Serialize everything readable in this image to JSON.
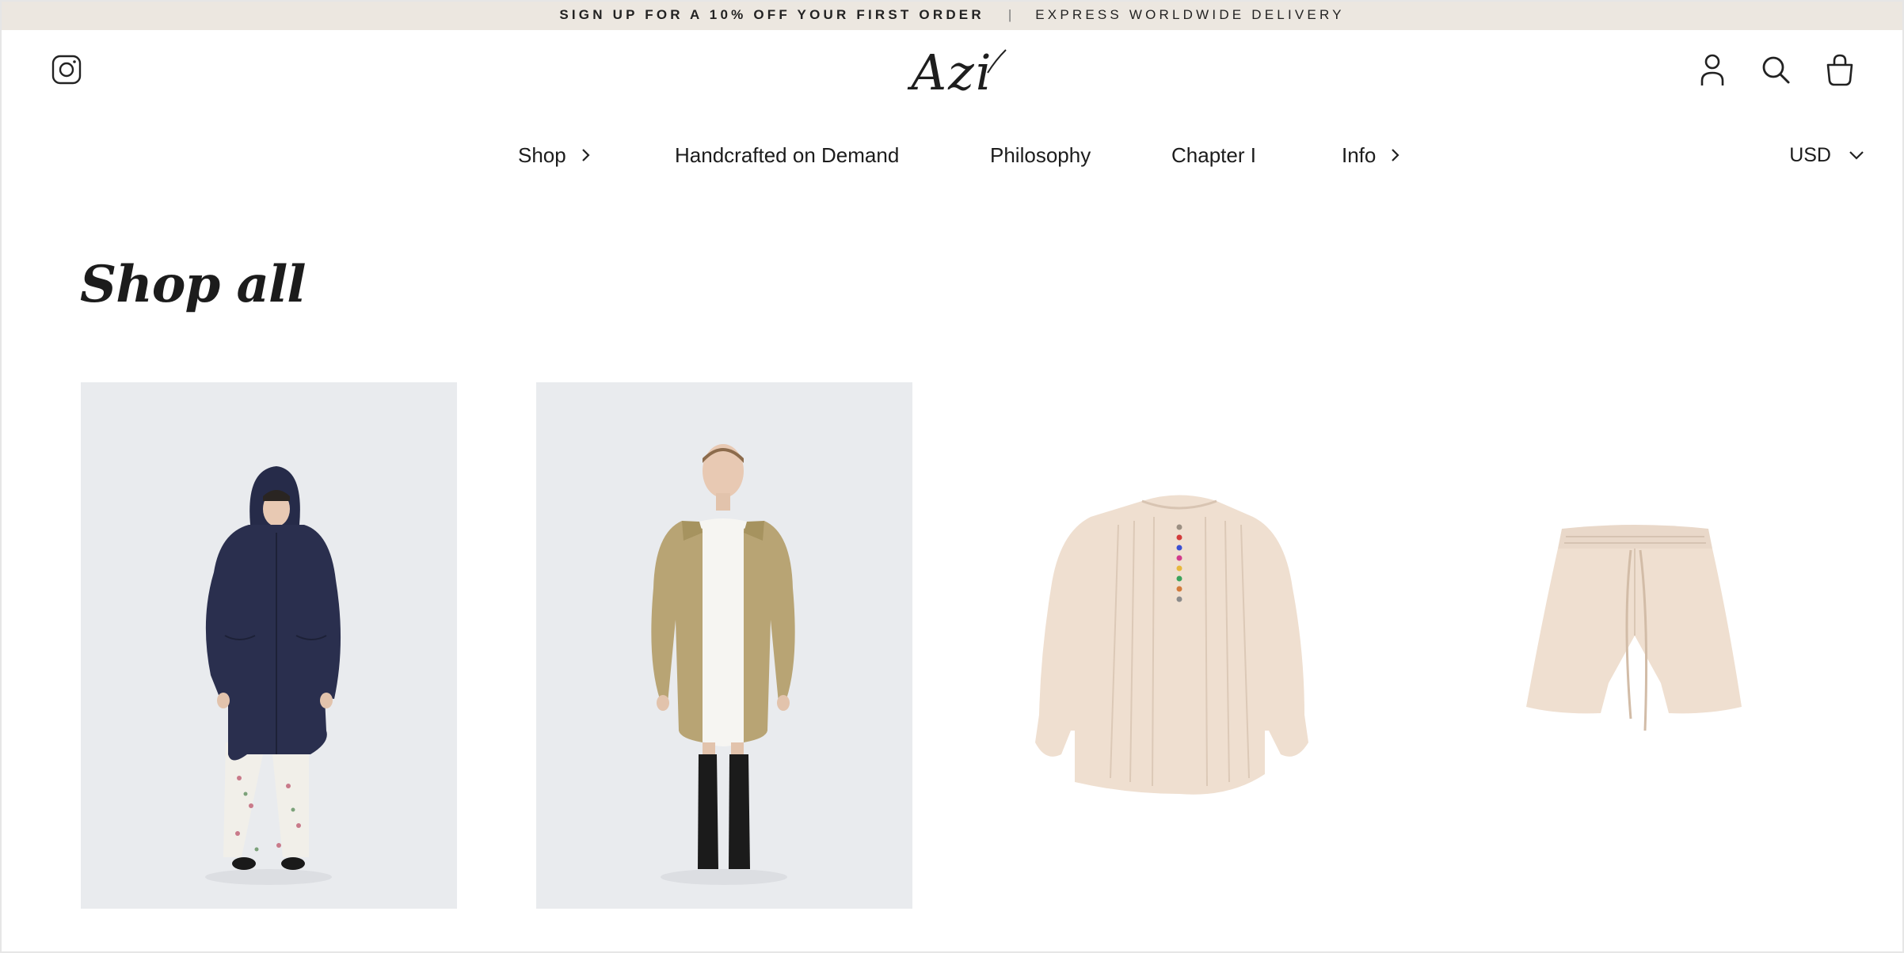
{
  "announcement": {
    "left": "SIGN UP FOR A 10% OFF YOUR FIRST ORDER",
    "separator": "|",
    "right": "EXPRESS WORLDWIDE DELIVERY"
  },
  "header": {
    "logo": "Azi",
    "icons": {
      "social": "instagram-icon",
      "account": "account-icon",
      "search": "search-icon",
      "cart": "bag-icon"
    }
  },
  "nav": {
    "items": [
      {
        "label": "Shop",
        "has_submenu": true
      },
      {
        "label": "Handcrafted on Demand",
        "has_submenu": false
      },
      {
        "label": "Philosophy",
        "has_submenu": false
      },
      {
        "label": "Chapter I",
        "has_submenu": false
      },
      {
        "label": "Info",
        "has_submenu": true
      }
    ],
    "currency": "USD"
  },
  "page": {
    "title": "Shop all"
  },
  "colors": {
    "announcement_bg": "#ece7e0",
    "text": "#1f1f1f",
    "photo_bg": "#e9ebee",
    "navy_coat": "#2a2f4e",
    "khaki_coat": "#b8a474",
    "cream_garment": "#efdfd0"
  },
  "products": [
    {
      "image": "navy hooded parka on model"
    },
    {
      "image": "khaki hooded parka on model"
    },
    {
      "image": "cream pleated blouse with colored buttons"
    },
    {
      "image": "cream drawstring shorts"
    }
  ]
}
